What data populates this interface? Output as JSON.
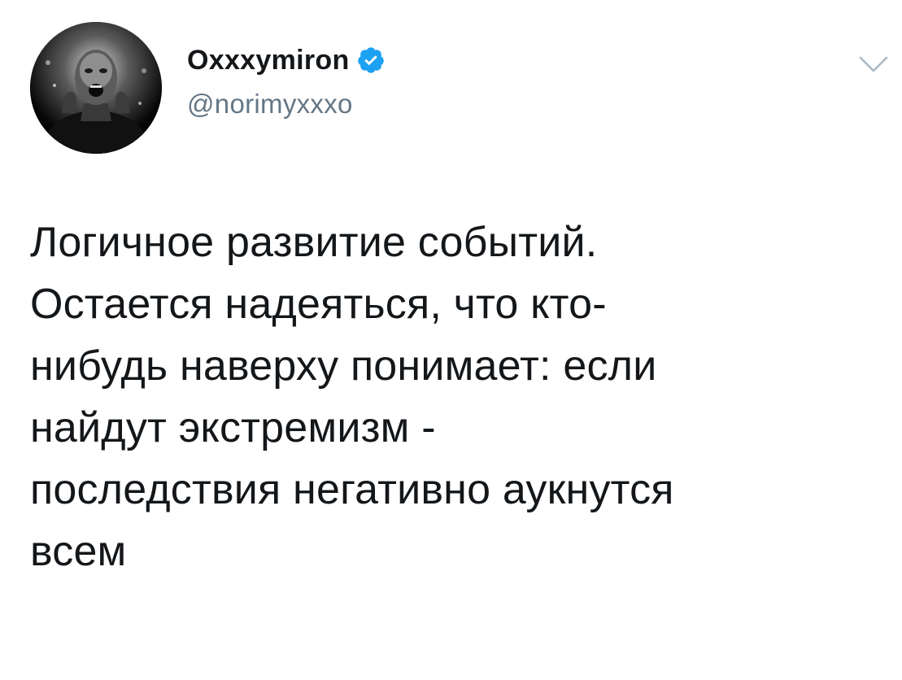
{
  "tweet": {
    "author": {
      "display_name": "Oxxxymiron",
      "handle": "@norimyxxxo",
      "verified": true,
      "avatar_icon": "user-avatar-photo"
    },
    "menu_icon": "chevron-down-icon",
    "text_lines": [
      "Логичное развитие событий.",
      "Остается надеяться, что кто-",
      "нибудь наверху понимает: если",
      "найдут экстремизм -",
      "последствия негативно аукнутся",
      "всем"
    ]
  },
  "colors": {
    "verified_blue": "#1da1f2",
    "handle_gray": "#657786",
    "text": "#14171a",
    "caret_gray": "#aab8c2"
  }
}
